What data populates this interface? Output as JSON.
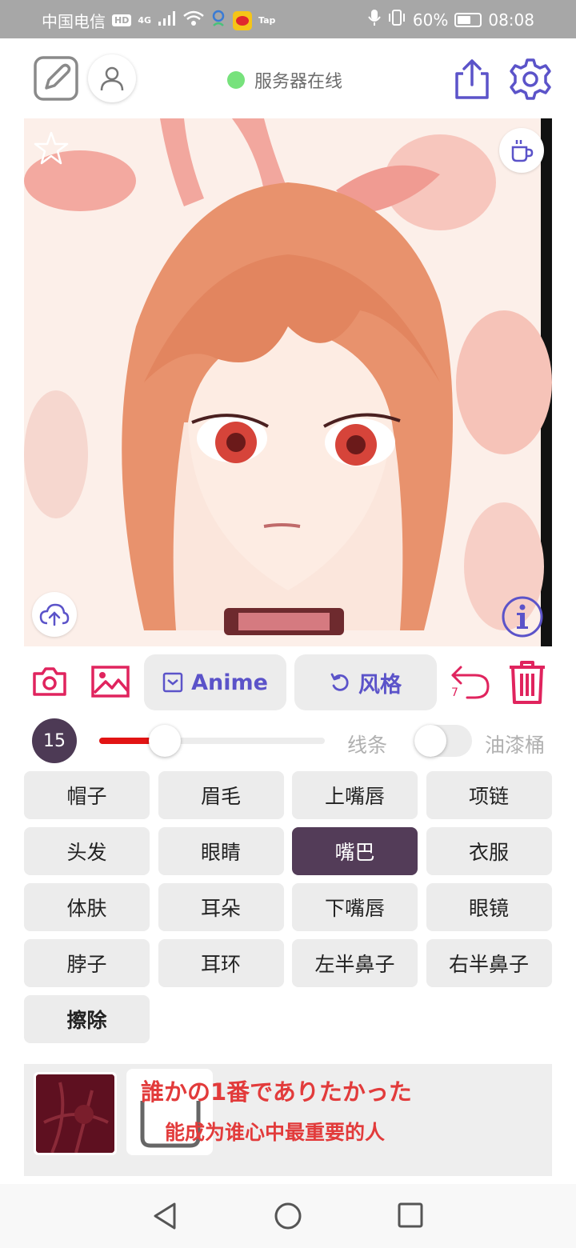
{
  "status_bar": {
    "carrier": "中国电信",
    "hd_badge": "HD",
    "network": "4G",
    "tap_label": "Tap",
    "battery": "60%",
    "time": "08:08"
  },
  "header": {
    "server_status": "服务器在线",
    "server_status_color": "#77e27c"
  },
  "canvas": {
    "image_description": "anime portrait"
  },
  "toolbar": {
    "anime_label": "Anime",
    "style_label": "风格",
    "undo_count": "7",
    "accent_color": "#e0245e",
    "button_text_color": "#5b53c9"
  },
  "brush": {
    "size": "15",
    "slider_level": 0.29,
    "line_label": "线条",
    "bucket_label": "油漆桶",
    "bucket_enabled": false
  },
  "parts": [
    {
      "label": "帽子"
    },
    {
      "label": "眉毛"
    },
    {
      "label": "上嘴唇"
    },
    {
      "label": "项链"
    },
    {
      "label": "头发"
    },
    {
      "label": "眼睛"
    },
    {
      "label": "嘴巴",
      "selected": true
    },
    {
      "label": "衣服"
    },
    {
      "label": "体肤"
    },
    {
      "label": "耳朵"
    },
    {
      "label": "下嘴唇"
    },
    {
      "label": "眼镜"
    },
    {
      "label": "脖子"
    },
    {
      "label": "耳环"
    },
    {
      "label": "左半鼻子"
    },
    {
      "label": "右半鼻子"
    },
    {
      "label": "擦除"
    }
  ],
  "history": {
    "jp_text": "誰かの1番でありたかった",
    "cn_text": "能成为谁心中最重要的人"
  }
}
